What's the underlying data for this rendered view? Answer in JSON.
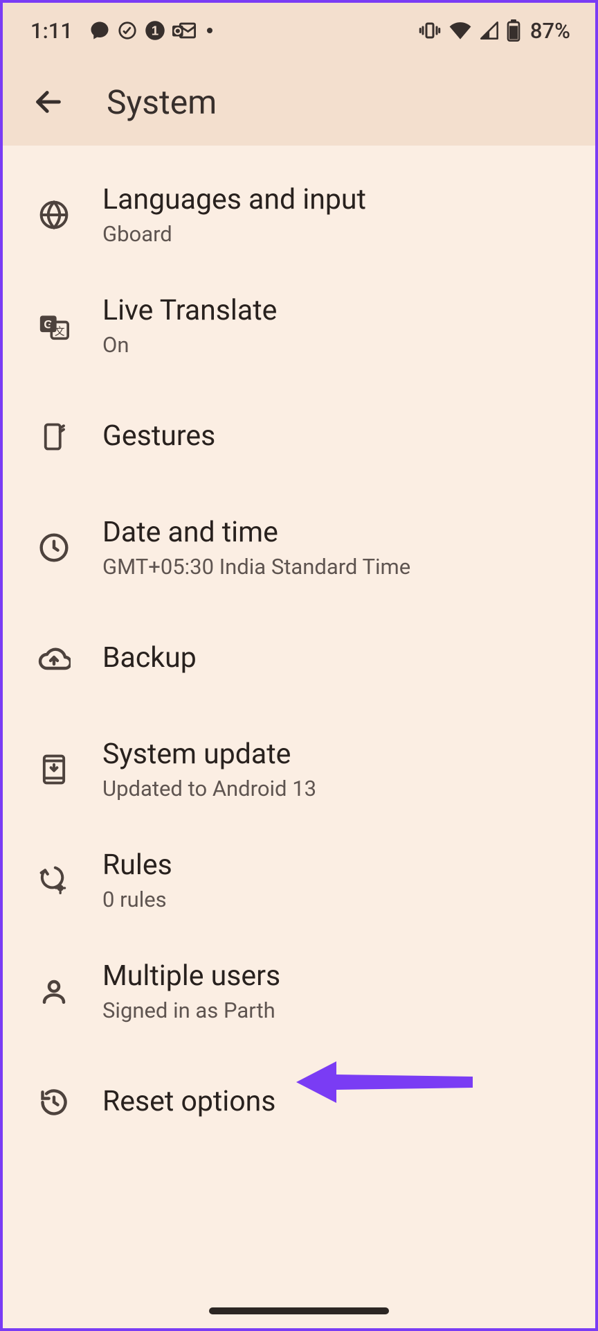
{
  "status": {
    "time": "1:11",
    "battery_text": "87%"
  },
  "header": {
    "title": "System"
  },
  "items": [
    {
      "title": "Languages and input",
      "sub": "Gboard"
    },
    {
      "title": "Live Translate",
      "sub": "On"
    },
    {
      "title": "Gestures",
      "sub": ""
    },
    {
      "title": "Date and time",
      "sub": "GMT+05:30 India Standard Time"
    },
    {
      "title": "Backup",
      "sub": ""
    },
    {
      "title": "System update",
      "sub": "Updated to Android 13"
    },
    {
      "title": "Rules",
      "sub": "0 rules"
    },
    {
      "title": "Multiple users",
      "sub": "Signed in as Parth"
    },
    {
      "title": "Reset options",
      "sub": ""
    }
  ],
  "annotation": {
    "color": "#7a3cf4"
  }
}
